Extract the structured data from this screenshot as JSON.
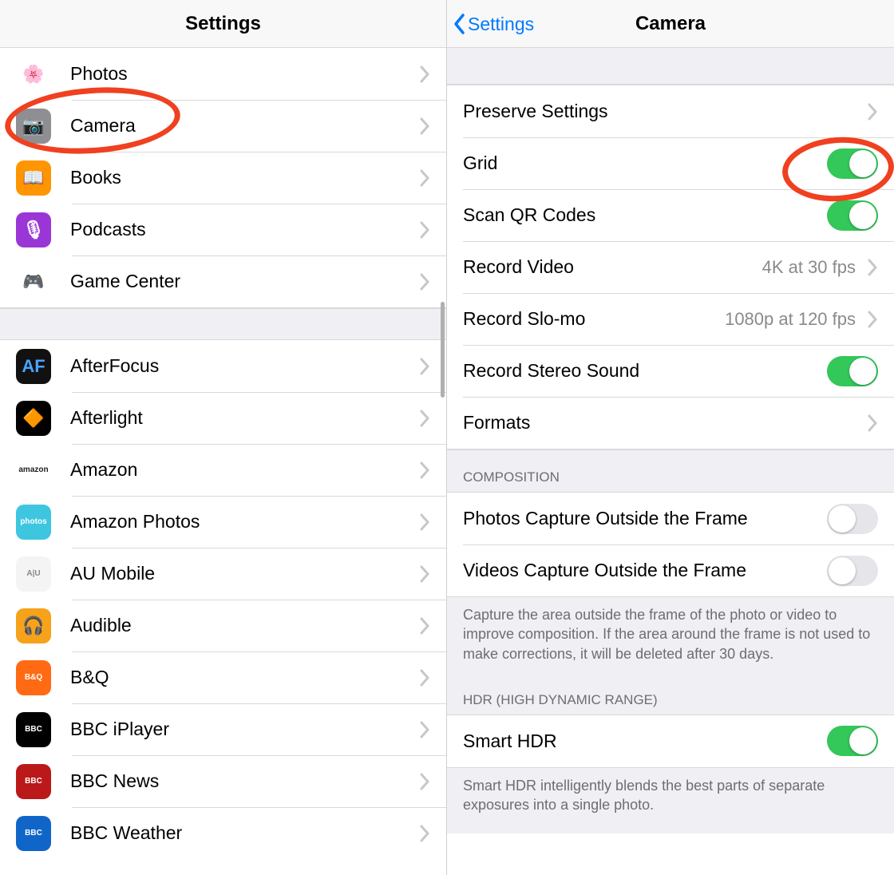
{
  "left": {
    "title": "Settings",
    "items": [
      {
        "label": "Photos",
        "icon_bg": "#fff",
        "icon_emoji": "🌸"
      },
      {
        "label": "Camera",
        "icon_bg": "#8e8e93",
        "icon_emoji": "📷"
      },
      {
        "label": "Books",
        "icon_bg": "#ff9500",
        "icon_emoji": "📖"
      },
      {
        "label": "Podcasts",
        "icon_bg": "#9b36d6",
        "icon_emoji": "🎙"
      },
      {
        "label": "Game Center",
        "icon_bg": "#fff",
        "icon_emoji": "🎮"
      }
    ],
    "apps": [
      {
        "label": "AfterFocus",
        "icon_bg": "#111",
        "icon_text": "AF",
        "text_color": "#4aa3ff"
      },
      {
        "label": "Afterlight",
        "icon_bg": "#000",
        "icon_emoji": "🔶"
      },
      {
        "label": "Amazon",
        "icon_bg": "#fff",
        "icon_text": "amazon",
        "text_color": "#222",
        "small": true
      },
      {
        "label": "Amazon Photos",
        "icon_bg": "#3ec6e0",
        "icon_text": "photos",
        "text_color": "#fff",
        "small": true
      },
      {
        "label": "AU Mobile",
        "icon_bg": "#f4f4f4",
        "icon_text": "A|U",
        "text_color": "#888",
        "small": true
      },
      {
        "label": "Audible",
        "icon_bg": "#f6a21b",
        "icon_emoji": "🎧"
      },
      {
        "label": "B&Q",
        "icon_bg": "#ff6a13",
        "icon_text": "B&Q",
        "text_color": "#fff",
        "small": true
      },
      {
        "label": "BBC iPlayer",
        "icon_bg": "#000",
        "icon_text": "BBC",
        "text_color": "#fff",
        "small": true
      },
      {
        "label": "BBC News",
        "icon_bg": "#bb1919",
        "icon_text": "BBC",
        "text_color": "#fff",
        "small": true
      },
      {
        "label": "BBC Weather",
        "icon_bg": "#1066c8",
        "icon_text": "BBC",
        "text_color": "#fff",
        "small": true
      }
    ]
  },
  "right": {
    "back": "Settings",
    "title": "Camera",
    "rows1": [
      {
        "label": "Preserve Settings",
        "type": "nav"
      },
      {
        "label": "Grid",
        "type": "toggle",
        "on": true
      },
      {
        "label": "Scan QR Codes",
        "type": "toggle",
        "on": true
      },
      {
        "label": "Record Video",
        "type": "detail",
        "detail": "4K at 30 fps"
      },
      {
        "label": "Record Slo-mo",
        "type": "detail",
        "detail": "1080p at 120 fps"
      },
      {
        "label": "Record Stereo Sound",
        "type": "toggle",
        "on": true
      },
      {
        "label": "Formats",
        "type": "nav"
      }
    ],
    "composition_header": "COMPOSITION",
    "rows2": [
      {
        "label": "Photos Capture Outside the Frame",
        "type": "toggle",
        "on": false
      },
      {
        "label": "Videos Capture Outside the Frame",
        "type": "toggle",
        "on": false
      }
    ],
    "composition_footer": "Capture the area outside the frame of the photo or video to improve composition. If the area around the frame is not used to make corrections, it will be deleted after 30 days.",
    "hdr_header": "HDR (HIGH DYNAMIC RANGE)",
    "rows3": [
      {
        "label": "Smart HDR",
        "type": "toggle",
        "on": true
      }
    ],
    "hdr_footer": "Smart HDR intelligently blends the best parts of separate exposures into a single photo."
  },
  "colors": {
    "accent": "#007aff",
    "toggle_on": "#34c759",
    "annotation": "#f0401f"
  }
}
